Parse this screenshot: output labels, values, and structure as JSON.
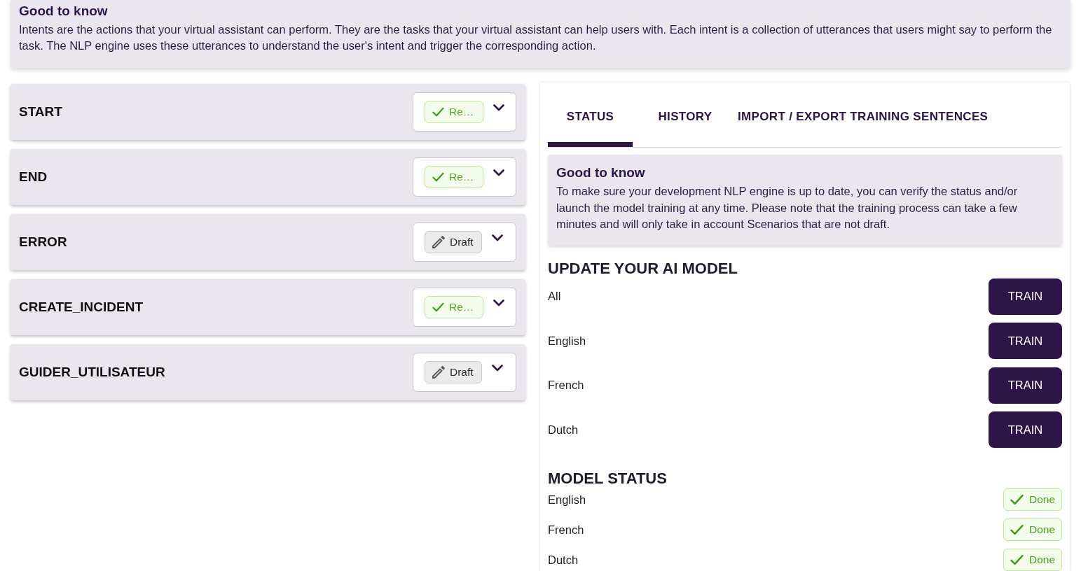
{
  "info_banner": {
    "title": "Good to know",
    "text": "Intents are the actions that your virtual assistant can perform. They are the tasks that your virtual assistant can help users with. Each intent is a collection of utterances that users might say to perform the task. The NLP engine uses these utterances to understand the user's intent and trigger the corresponding action."
  },
  "intents": [
    {
      "name": "START",
      "expanded": false,
      "status": {
        "kind": "ready",
        "label": "Re…"
      }
    },
    {
      "name": "END",
      "expanded": false,
      "status": {
        "kind": "ready",
        "label": "Re…"
      }
    },
    {
      "name": "ERROR",
      "expanded": false,
      "status": {
        "kind": "draft",
        "label": "Draft"
      }
    },
    {
      "name": "CREATE_INCIDENT",
      "expanded": false,
      "status": {
        "kind": "ready",
        "label": "Re…"
      }
    },
    {
      "name": "GUIDER_UTILISATEUR",
      "expanded": false,
      "status": {
        "kind": "draft",
        "label": "Draft"
      }
    }
  ],
  "panel": {
    "tabs": [
      {
        "label": "STATUS",
        "selected": true
      },
      {
        "label": "HISTORY",
        "selected": false
      },
      {
        "label": "IMPORT / EXPORT TRAINING SENTENCES",
        "selected": false
      }
    ],
    "info": {
      "title": "Good to know",
      "text": "To make sure your development NLP engine is up to date, you can verify the status and/or launch the model training at any time. Please note that the training process can take a few minutes and will only take in account Scenarios that are not draft."
    },
    "update_model": {
      "title": "UPDATE YOUR AI MODEL",
      "rows": [
        {
          "label": "All",
          "button": "TRAIN"
        },
        {
          "label": "English",
          "button": "TRAIN"
        },
        {
          "label": "French",
          "button": "TRAIN"
        },
        {
          "label": "Dutch",
          "button": "TRAIN"
        }
      ]
    },
    "model_status": {
      "title": "MODEL STATUS",
      "rows": [
        {
          "label": "English",
          "status": {
            "kind": "done",
            "label": "Done"
          }
        },
        {
          "label": "French",
          "status": {
            "kind": "done",
            "label": "Done"
          }
        },
        {
          "label": "Dutch",
          "status": {
            "kind": "done",
            "label": "Done"
          }
        }
      ]
    }
  }
}
